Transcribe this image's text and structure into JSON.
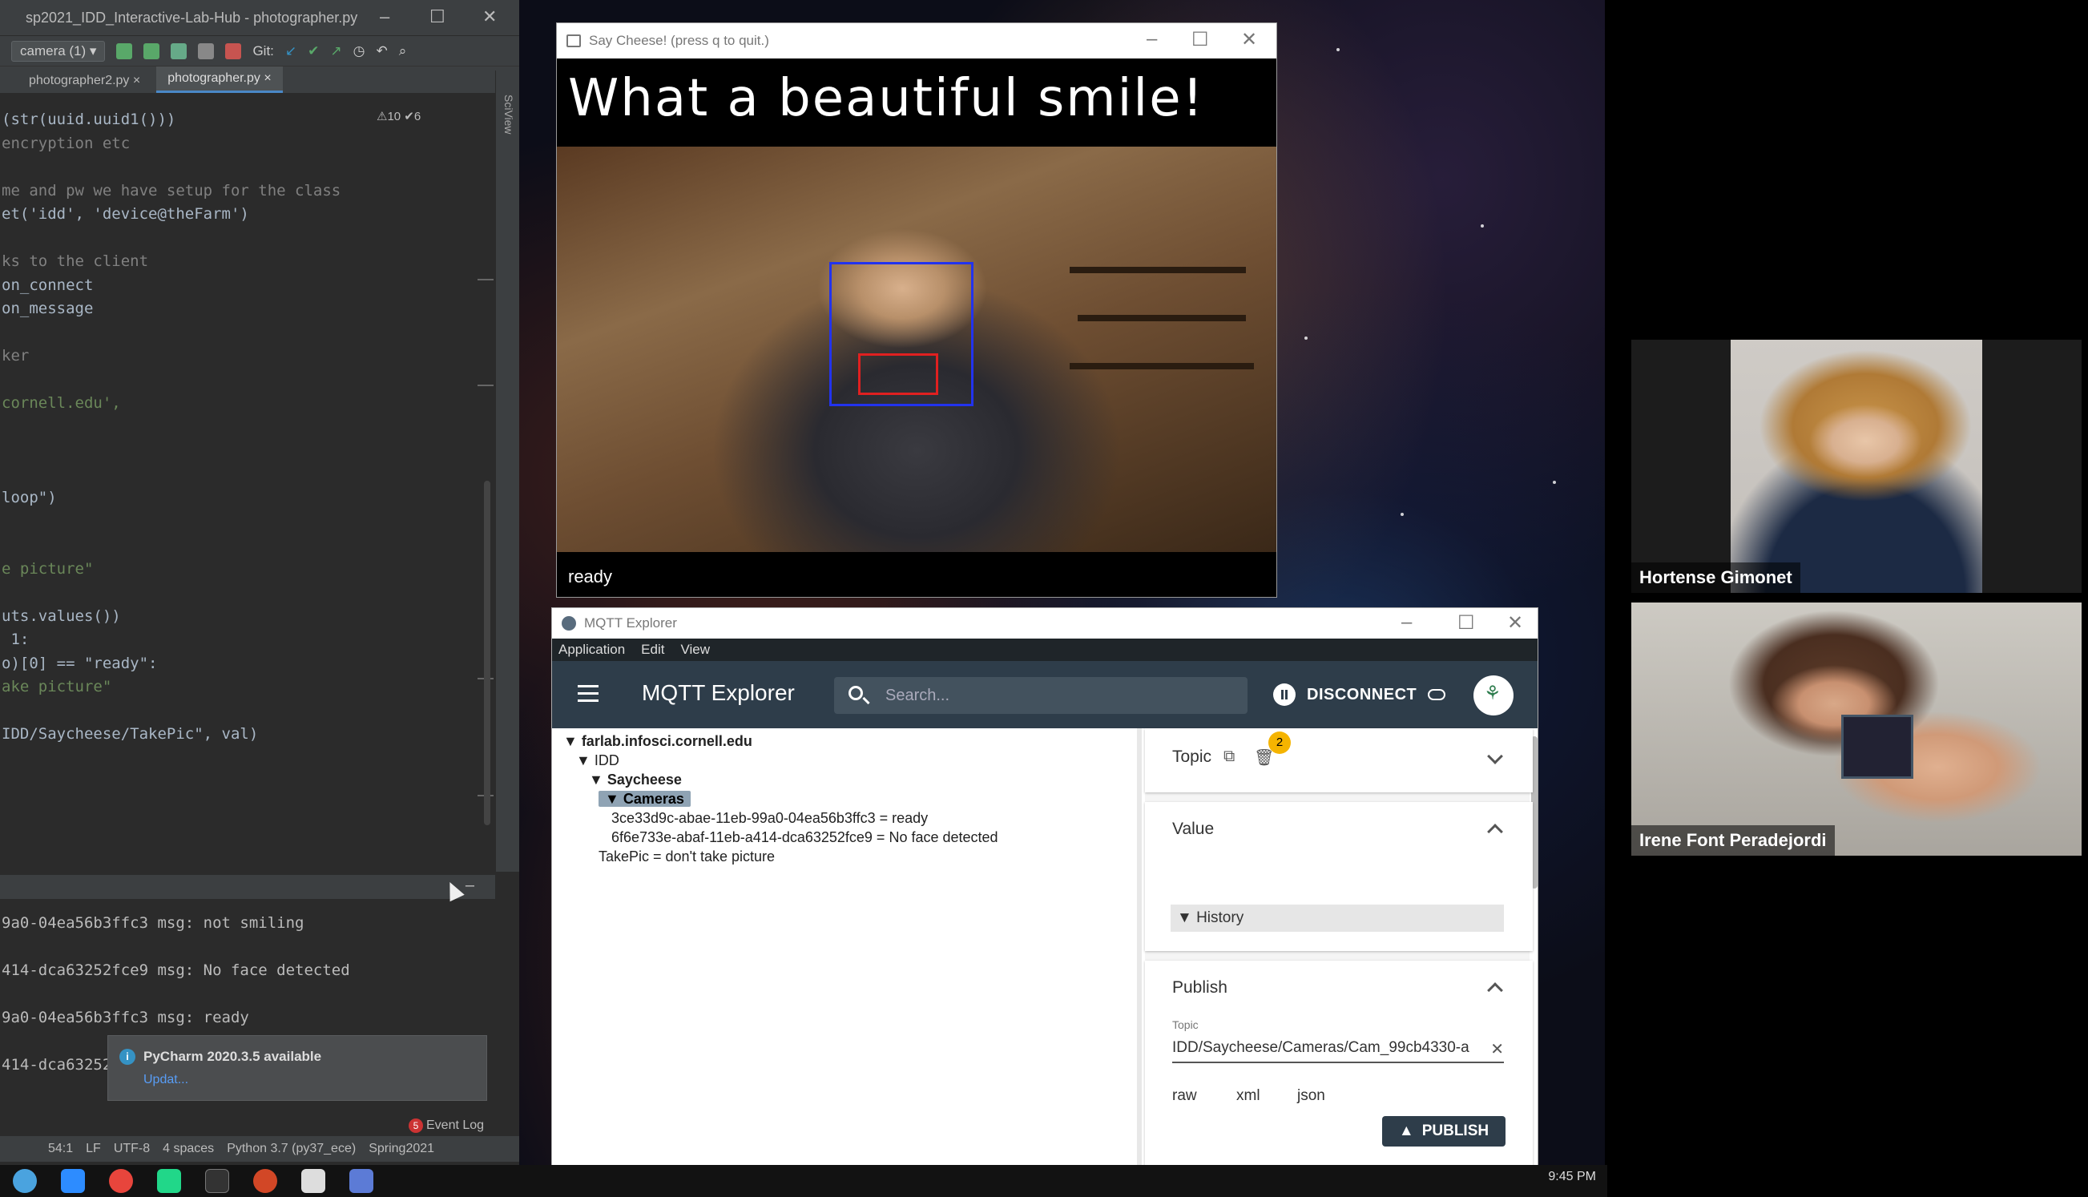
{
  "pycharm": {
    "window_title": "sp2021_IDD_Interactive-Lab-Hub - photographer.py",
    "run_config": "camera (1)",
    "git_label": "Git:",
    "tabs": [
      {
        "label": "photographer2.py"
      },
      {
        "label": "photographer.py"
      }
    ],
    "inspection": "⚠10 ✔6",
    "sidebar_label": "SciView",
    "code_lines": [
      {
        "text": "(str(uuid.uuid1()))",
        "kind": "code"
      },
      {
        "text": "encryption etc",
        "kind": "cmt"
      },
      {
        "text": "",
        "kind": "code"
      },
      {
        "text": "me and pw we have setup for the class",
        "kind": "cmt"
      },
      {
        "text": "et('idd', 'device@theFarm')",
        "kind": "code"
      },
      {
        "text": "",
        "kind": "code"
      },
      {
        "text": "ks to the client",
        "kind": "cmt"
      },
      {
        "text": "on_connect",
        "kind": "code"
      },
      {
        "text": "on_message",
        "kind": "code"
      },
      {
        "text": "",
        "kind": "code"
      },
      {
        "text": "ker",
        "kind": "cmt"
      },
      {
        "text": "",
        "kind": "code"
      },
      {
        "text": "cornell.edu',",
        "kind": "str"
      },
      {
        "text": "",
        "kind": "code"
      },
      {
        "text": "",
        "kind": "code"
      },
      {
        "text": "",
        "kind": "code"
      },
      {
        "text": "loop\")",
        "kind": "code"
      },
      {
        "text": "",
        "kind": "code"
      },
      {
        "text": "",
        "kind": "code"
      },
      {
        "text": "e picture\"",
        "kind": "str"
      },
      {
        "text": "",
        "kind": "hl"
      },
      {
        "text": "uts.values())",
        "kind": "code"
      },
      {
        "text": " 1:",
        "kind": "code"
      },
      {
        "text": "o)[0] == \"ready\":",
        "kind": "code"
      },
      {
        "text": "ake picture\"",
        "kind": "str"
      },
      {
        "text": "",
        "kind": "code"
      },
      {
        "text": "IDD/Saycheese/TakePic\", val)",
        "kind": "code"
      }
    ],
    "run_lines": [
      "9a0-04ea56b3ffc3 msg: not smiling",
      "",
      "414-dca63252fce9 msg: No face detected",
      "",
      "9a0-04ea56b3ffc3 msg: ready",
      "",
      "414-dca63252"
    ],
    "notification": {
      "title": "PyCharm 2020.3.5 available",
      "link": "Updat..."
    },
    "event_log": "Event Log",
    "event_count": "5",
    "status": [
      "54:1",
      "LF",
      "UTF-8",
      "4 spaces",
      "Python 3.7 (py37_ece)",
      "Spring2021"
    ]
  },
  "cheese": {
    "window_title": "Say Cheese! (press q to quit.)",
    "headline": "What a beautiful smile!",
    "status": "ready"
  },
  "mqtt": {
    "window_title": "MQTT Explorer",
    "menu": [
      "Application",
      "Edit",
      "View"
    ],
    "app_title": "MQTT Explorer",
    "search_placeholder": "Search...",
    "disconnect": "DISCONNECT",
    "tree": [
      {
        "label": "▼ farlab.infosci.cornell.edu",
        "bold": true,
        "indent": 0
      },
      {
        "label": "▼ IDD",
        "bold": false,
        "indent": 1
      },
      {
        "label": "▼ Saycheese",
        "bold": true,
        "indent": 2
      },
      {
        "label": "▼ Cameras",
        "bold": true,
        "indent": 3,
        "selected": true
      },
      {
        "label": "3ce33d9c-abae-11eb-99a0-04ea56b3ffc3 = ready",
        "bold": false,
        "indent": 4
      },
      {
        "label": "6f6e733e-abaf-11eb-a414-dca63252fce9 = No face detected",
        "bold": false,
        "indent": 4
      },
      {
        "label": "TakePic = don't take picture",
        "bold": false,
        "indent": 3
      }
    ],
    "topic_label": "Topic",
    "topic_badge": "2",
    "value_label": "Value",
    "history_label": "▼ History",
    "publish_label": "Publish",
    "publish_topic_label": "Topic",
    "publish_topic_value": "IDD/Saycheese/Cameras/Cam_99cb4330-a",
    "formats": [
      "raw",
      "xml",
      "json"
    ],
    "publish_button": "PUBLISH"
  },
  "video": {
    "participants": [
      {
        "name": "Hortense Gimonet"
      },
      {
        "name": "Irene Font Peradejordi"
      }
    ]
  },
  "taskbar": {
    "time": "9:45 PM"
  }
}
